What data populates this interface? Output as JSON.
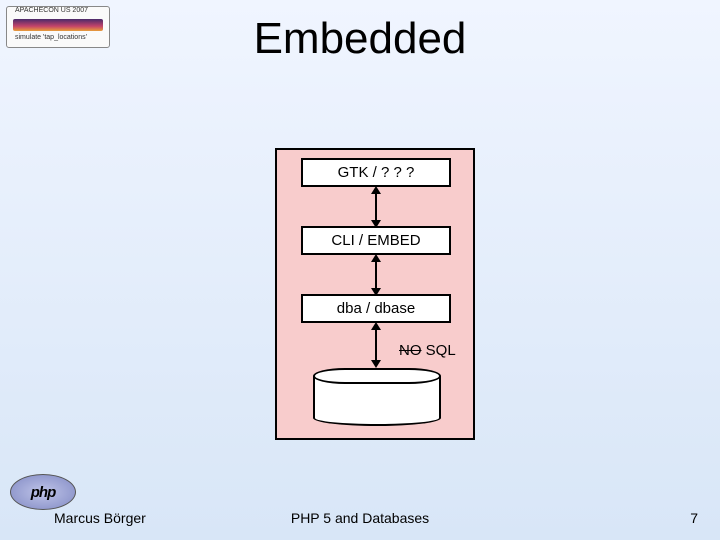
{
  "badge": {
    "line1": "APACHECON US 2007",
    "line2": "simulate 'tap_locations'"
  },
  "title": "Embedded",
  "diagram": {
    "layers": {
      "gtk": "GTK / ? ? ?",
      "cli": "CLI / EMBED",
      "dba": "dba / dbase"
    },
    "nosql": {
      "struck": "NO",
      "rest": " SQL"
    }
  },
  "footer": {
    "author": "Marcus Börger",
    "center": "PHP 5 and Databases",
    "page": "7"
  },
  "logo": "php"
}
